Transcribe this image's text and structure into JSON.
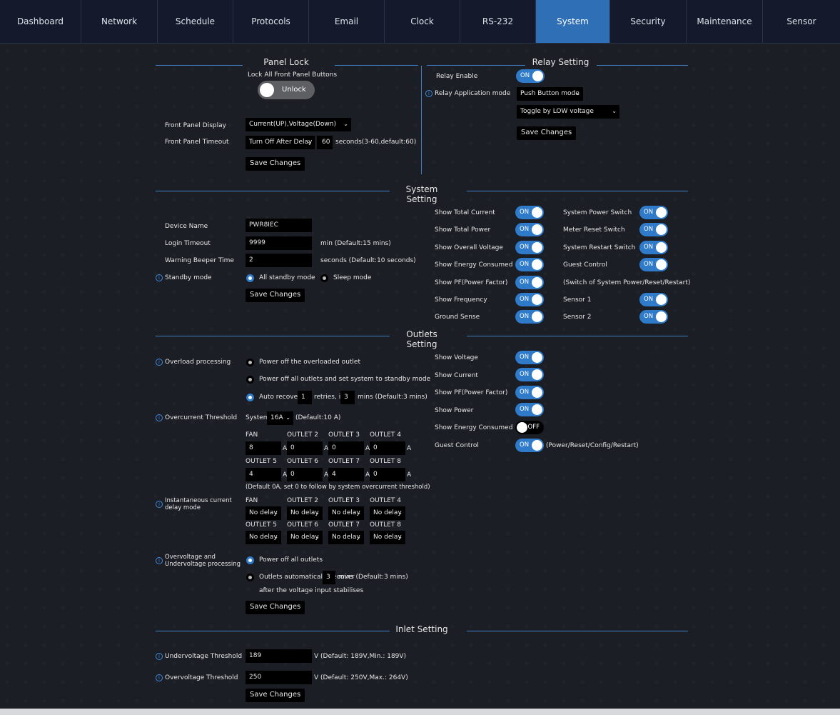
{
  "nav": {
    "tabs": [
      "Dashboard",
      "Network",
      "Schedule",
      "Protocols",
      "Email",
      "Clock",
      "RS-232",
      "System",
      "Security",
      "Maintenance",
      "Sensor"
    ],
    "active": "System"
  },
  "colors": {
    "accent": "#2e6fb6",
    "toggle_on": "#2f7bc9",
    "background": "#1b1e24",
    "field": "#000000"
  },
  "panel_lock": {
    "title": "Panel Lock",
    "lock_label": "Lock All Front Panel Buttons",
    "lock_state": "Unlock",
    "display_label": "Front Panel Display",
    "display_value": "Current(UP),Voltage(Down)",
    "timeout_label": "Front Panel Timeout",
    "timeout_mode": "Turn Off After Delay",
    "timeout_value": "60",
    "timeout_hint": "seconds(3-60,default:60)",
    "save": "Save Changes"
  },
  "relay": {
    "title": "Relay Setting",
    "enable_label": "Relay Enable",
    "enable_state": "ON",
    "mode_label": "Relay Application mode",
    "mode_value": "Push Button mode",
    "trigger_value": "Toggle by LOW voltage",
    "save": "Save Changes"
  },
  "system": {
    "title": "System Setting",
    "device_name_label": "Device Name",
    "device_name": "PWR8IEC",
    "login_timeout_label": "Login Timeout",
    "login_timeout": "9999",
    "login_timeout_hint": "min (Default:15 mins)",
    "beeper_label": "Warning Beeper Time",
    "beeper": "2",
    "beeper_hint": "seconds (Default:10 seconds)",
    "standby_label": "Standby mode",
    "standby_opt1": "All standby mode",
    "standby_opt2": "Sleep mode",
    "save": "Save Changes",
    "show_total_current": "Show Total Current",
    "show_total_power": "Show Total Power",
    "show_overall_voltage": "Show Overall Voltage",
    "show_energy_consumed": "Show Energy Consumed",
    "show_pf": "Show PF(Power Factor)",
    "show_frequency": "Show Frequency",
    "ground_sense": "Ground Sense",
    "system_power_switch": "System Power Switch",
    "meter_reset_switch": "Meter Reset Switch",
    "system_restart_switch": "System Restart Switch",
    "guest_control": "Guest Control",
    "switch_note": "(Switch of System Power/Reset/Restart)",
    "sensor1": "Sensor 1",
    "sensor2": "Sensor 2",
    "on": "ON",
    "off": "OFF"
  },
  "outlets": {
    "title": "Outlets Setting",
    "overload_label": "Overload processing",
    "overload_opt1": "Power off the overloaded outlet",
    "overload_opt2": "Power off all outlets and set system to standby mode",
    "overload_opt3_a": "Auto recover",
    "overload_retries": "1",
    "overload_opt3_b": "retries, in",
    "overload_mins": "3",
    "overload_opt3_c": "mins (Default:3 mins)",
    "overcurrent_label": "Overcurrent Threshold",
    "overcurrent_system": "System",
    "overcurrent_value": "16A",
    "overcurrent_hint": "(Default:10 A)",
    "headers_row1": [
      "FAN",
      "OUTLET 2",
      "OUTLET 3",
      "OUTLET 4"
    ],
    "values_row1": [
      "8",
      "0",
      "0",
      "0"
    ],
    "headers_row2": [
      "OUTLET 5",
      "OUTLET 6",
      "OUTLET 7",
      "OUTLET 8"
    ],
    "values_row2": [
      "4",
      "0",
      "4",
      "0"
    ],
    "unit": "A",
    "current_note": "(Default 0A, set 0 to follow by system overcurrent threshold)",
    "instant_label_1": "Instantaneous current",
    "instant_label_2": "delay mode",
    "delay_value": "No delay",
    "ovuv_label_1": "Overvoltage and",
    "ovuv_label_2": "Undervoltage processing",
    "ovuv_opt1": "Power off all outlets",
    "ovuv_opt2_a": "Outlets automatically recover",
    "ovuv_mins": "3",
    "ovuv_opt2_b": "mins (Default:3 mins)",
    "ovuv_opt2_c": "after the voltage input stabilises",
    "save": "Save Changes",
    "show_voltage": "Show Voltage",
    "show_current": "Show Current",
    "show_pf": "Show PF(Power Factor)",
    "show_power": "Show Power",
    "show_energy": "Show Energy Consumed",
    "guest_control": "Guest Control",
    "guest_note": "(Power/Reset/Config/Restart)"
  },
  "inlet": {
    "title": "Inlet Setting",
    "under_label": "Undervoltage Threshold",
    "under_value": "189",
    "under_hint": "V (Default: 189V,Min.: 189V)",
    "over_label": "Overvoltage Threshold",
    "over_value": "250",
    "over_hint": "V (Default: 250V,Max.: 264V)",
    "save": "Save Changes"
  },
  "icons": {
    "info": "info-icon",
    "chevron": "chevron-down-icon"
  }
}
